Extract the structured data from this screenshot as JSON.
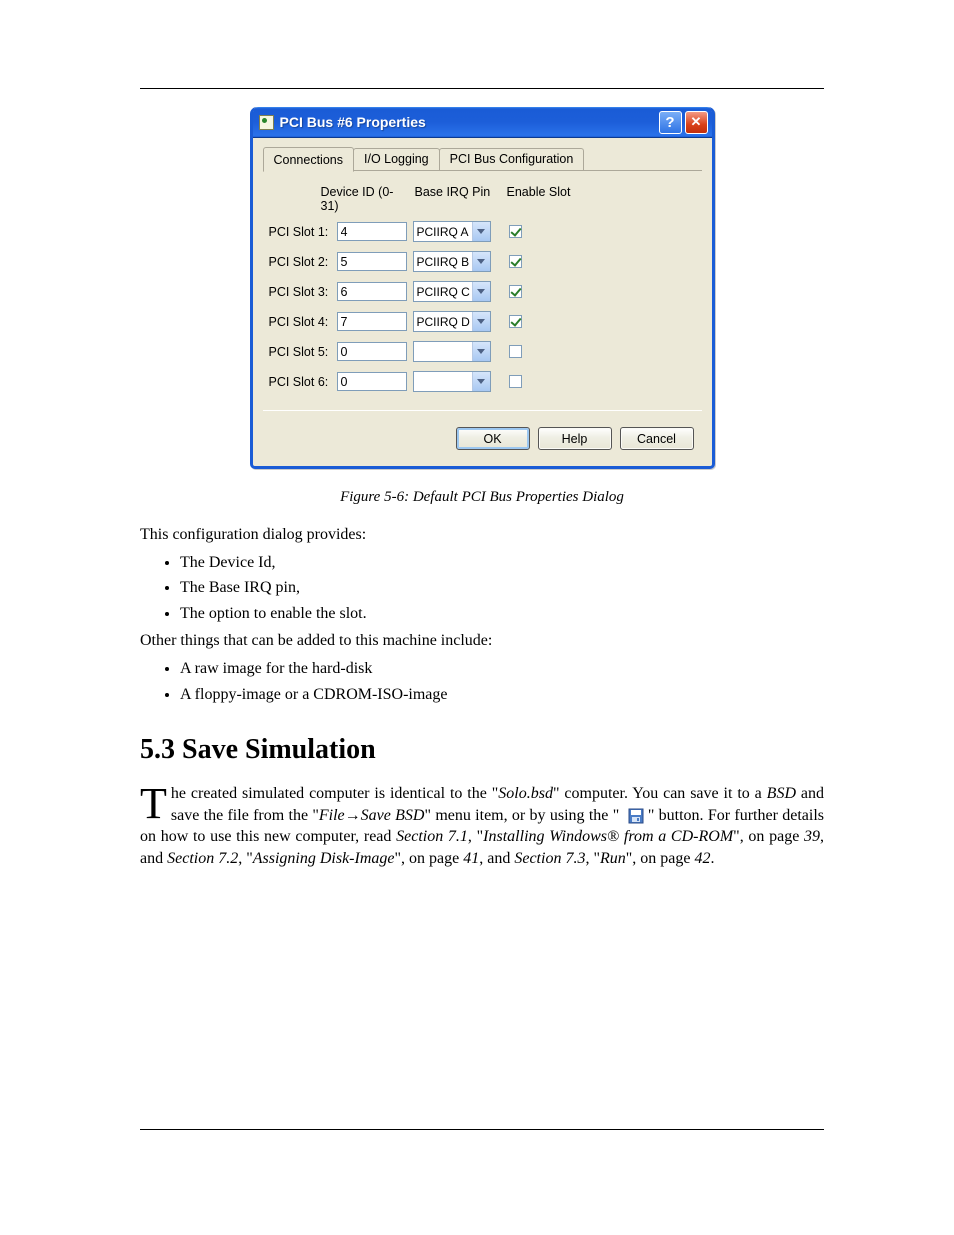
{
  "dialog": {
    "title": "PCI Bus #6 Properties",
    "tabs": [
      "Connections",
      "I/O Logging",
      "PCI Bus Configuration"
    ],
    "active_tab": 0,
    "columns": [
      "Device ID (0-31)",
      "Base IRQ Pin",
      "Enable Slot"
    ],
    "rows": [
      {
        "label": "PCI Slot 1:",
        "device_id": "4",
        "irq": "PCIIRQ A",
        "enabled": true
      },
      {
        "label": "PCI Slot 2:",
        "device_id": "5",
        "irq": "PCIIRQ B",
        "enabled": true
      },
      {
        "label": "PCI Slot 3:",
        "device_id": "6",
        "irq": "PCIIRQ C",
        "enabled": true
      },
      {
        "label": "PCI Slot 4:",
        "device_id": "7",
        "irq": "PCIIRQ D",
        "enabled": true
      },
      {
        "label": "PCI Slot 5:",
        "device_id": "0",
        "irq": "",
        "enabled": false
      },
      {
        "label": "PCI Slot 6:",
        "device_id": "0",
        "irq": "",
        "enabled": false
      }
    ],
    "buttons": {
      "ok": "OK",
      "help": "Help",
      "cancel": "Cancel"
    }
  },
  "figure_caption": "Figure 5-6: Default PCI Bus Properties Dialog",
  "intro": "This configuration dialog provides:",
  "bullets1": [
    "The Device Id,",
    "The Base IRQ pin,",
    "The option to enable the slot."
  ],
  "extra_line": "Other things that can be added to this machine include:",
  "bullets2": [
    "A raw image for the hard-disk",
    "A floppy-image or a CDROM-ISO-image"
  ],
  "section_title": "5.3 Save Simulation",
  "para": {
    "dropcap": "T",
    "t1": "he created simulated computer is identical to the \"",
    "link1": "Solo.bsd",
    "t2": "\" computer. You can save it to a ",
    "link2": "BSD",
    "t3": " and save the file from the \"",
    "menu1": "File",
    "arrow": "→",
    "menu2": "Save BSD",
    "t4": "\" menu item, or by using the \" ",
    "t5": " \" button. For further details on how to use this new computer, read ",
    "ref1a": "Section 7.1",
    "ref1b": ", \"",
    "ref1c": "Installing Windows® from a CD-ROM",
    "ref1d": "\", on page ",
    "ref1p": "39",
    "ref2a": "Section 7.2",
    "ref2b": ", \"",
    "ref2c": "Assigning Disk-Image",
    "ref2d": "\", on page ",
    "ref2p": "41",
    "sep": ", and ",
    "ref3a": "Section 7.3",
    "ref3b": ", \"",
    "ref3c": "Run",
    "ref3d": "\", on page ",
    "ref3p": "42",
    "period": "."
  }
}
